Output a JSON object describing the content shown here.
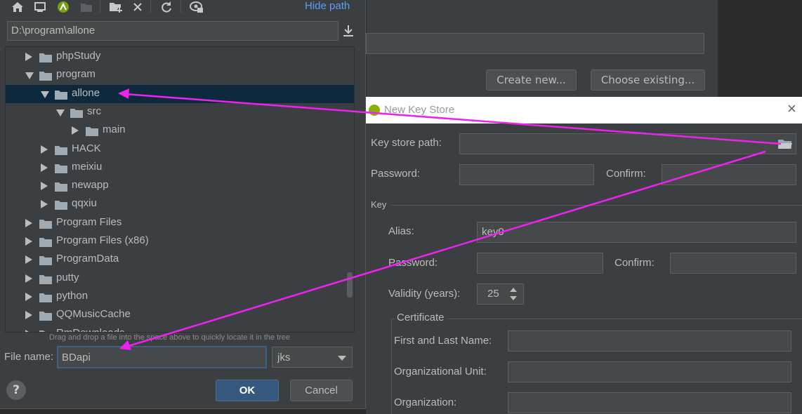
{
  "background": {
    "create_new_label": "Create new...",
    "choose_existing_label": "Choose existing..."
  },
  "file_chooser": {
    "hide_path_label": "Hide path",
    "path_value": "D:\\program\\allone",
    "tree": [
      {
        "label": "phpStudy",
        "expanded": false
      },
      {
        "label": "program",
        "expanded": true
      },
      {
        "label": "allone",
        "expanded": true,
        "selected": true
      },
      {
        "label": "src",
        "expanded": true
      },
      {
        "label": "main",
        "expanded": false
      },
      {
        "label": "HACK",
        "expanded": false
      },
      {
        "label": "meixiu",
        "expanded": false
      },
      {
        "label": "newapp",
        "expanded": false
      },
      {
        "label": "qqxiu",
        "expanded": false
      },
      {
        "label": "Program Files",
        "expanded": false
      },
      {
        "label": "Program Files (x86)",
        "expanded": false
      },
      {
        "label": "ProgramData",
        "expanded": false
      },
      {
        "label": "putty",
        "expanded": false
      },
      {
        "label": "python",
        "expanded": false
      },
      {
        "label": "QQMusicCache",
        "expanded": false
      },
      {
        "label": "RmDownloads",
        "expanded": false
      }
    ],
    "drag_hint": "Drag and drop a file into the space above to quickly locate it in the tree",
    "file_name_label": "File name:",
    "file_name_value": "BDapi",
    "extension_selected": "jks",
    "help_label": "?",
    "ok_label": "OK",
    "cancel_label": "Cancel"
  },
  "key_store_dialog": {
    "title": "New Key Store",
    "close_label": "×",
    "key_store_path_label": "Key store path:",
    "password_label": "Password:",
    "confirm_label": "Confirm:",
    "key_section_label": "Key",
    "alias_label": "Alias:",
    "alias_value": "key0",
    "key_password_label": "Password:",
    "key_confirm_label": "Confirm:",
    "validity_label": "Validity (years):",
    "validity_value": "25",
    "certificate_label": "Certificate",
    "first_last_label": "First and Last Name:",
    "org_unit_label": "Organizational Unit:",
    "organization_label": "Organization:"
  },
  "colors": {
    "panel_bg": "#3c3f41",
    "field_bg": "#45494a",
    "selection": "#0d293e",
    "link": "#589df6",
    "annotation_arrow": "#ee22ee"
  }
}
